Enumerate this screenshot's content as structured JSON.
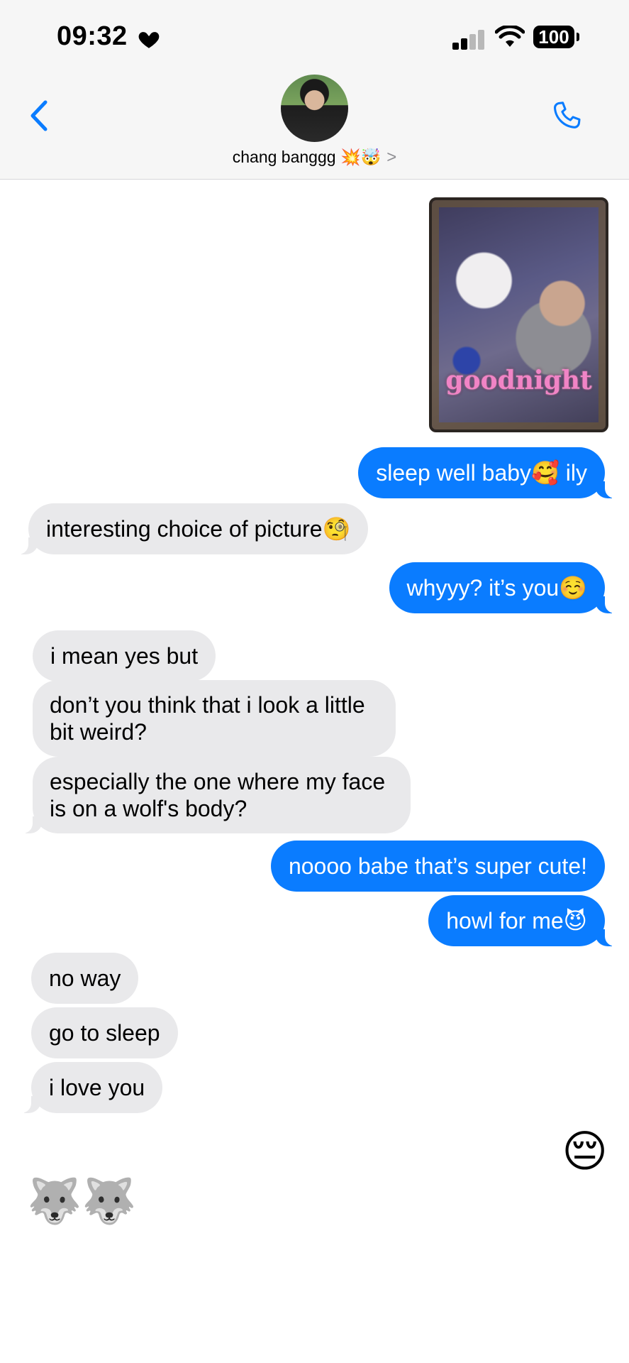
{
  "status_bar": {
    "time": "09:32",
    "battery": "100"
  },
  "contact": {
    "name": "chang banggg 💥🤯",
    "chevron": ">"
  },
  "photo": {
    "caption": "goodnight"
  },
  "messages": [
    {
      "side": "sent",
      "text": "sleep well baby🥰 ily"
    },
    {
      "side": "received",
      "text": "interesting choice of picture🧐"
    },
    {
      "side": "sent",
      "text": "whyyy? it’s you☺️"
    },
    {
      "side": "received",
      "text": "i mean yes but"
    },
    {
      "side": "received",
      "text": "don’t you think that i look a little bit weird?"
    },
    {
      "side": "received",
      "text": "especially the one where my face is on a wolf's body?"
    },
    {
      "side": "sent",
      "text": "noooo babe that’s super cute!"
    },
    {
      "side": "sent",
      "text": "howl for me😈"
    },
    {
      "side": "received",
      "text": "no way"
    },
    {
      "side": "received",
      "text": "go to sleep"
    },
    {
      "side": "received",
      "text": "i love you"
    },
    {
      "side": "sent",
      "text": "😔"
    },
    {
      "side": "received",
      "text": "🐺🐺"
    }
  ],
  "colors": {
    "sent_bubble": "#0a7cff",
    "received_bubble": "#e9e9eb",
    "accent": "#0a7cff"
  }
}
